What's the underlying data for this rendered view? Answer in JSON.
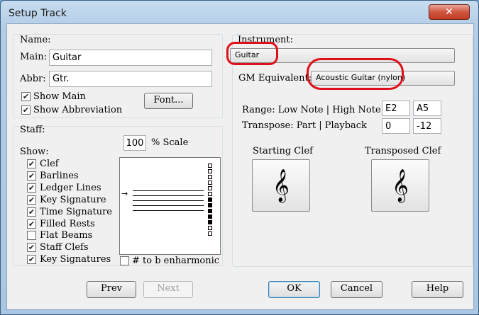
{
  "window": {
    "title": "Setup Track",
    "close_glyph": "✕"
  },
  "name_group": {
    "legend": "Name:",
    "main_label": "Main:",
    "main_value": "Guitar",
    "abbr_label": "Abbr:",
    "abbr_value": "Gtr.",
    "show_main": "Show Main",
    "show_abbreviation": "Show Abbreviation",
    "font_button": "Font..."
  },
  "staff_group": {
    "legend": "Staff:",
    "scale_value": "100",
    "scale_label": "% Scale",
    "show_label": "Show:",
    "options": [
      {
        "label": "Clef",
        "checked": true
      },
      {
        "label": "Barlines",
        "checked": true
      },
      {
        "label": "Ledger Lines",
        "checked": true
      },
      {
        "label": "Key Signature",
        "checked": true
      },
      {
        "label": "Time Signature",
        "checked": true
      },
      {
        "label": "Filled Rests",
        "checked": true
      },
      {
        "label": "Flat Beams",
        "checked": false
      },
      {
        "label": "Staff Clefs",
        "checked": true
      },
      {
        "label": "Key Signatures",
        "checked": true
      }
    ],
    "enharmonic_label": "# to b enharmonic",
    "enharmonic_checked": false
  },
  "instrument_group": {
    "legend": "Instrument:",
    "instrument_value": "Guitar",
    "gm_label": "GM Equivalent:",
    "gm_value": "Acoustic Guitar (nylon)",
    "range_label": "Range:  Low Note | High Note",
    "low_note": "E2",
    "high_note": "A5",
    "transpose_label": "Transpose:    Part | Playback",
    "transpose_part": "0",
    "transpose_playback": "-12",
    "starting_clef_label": "Starting Clef",
    "transposed_clef_label": "Transposed Clef",
    "clef_glyph": "𝄞"
  },
  "buttons": {
    "prev": "Prev",
    "next": "Next",
    "ok": "OK",
    "cancel": "Cancel",
    "help": "Help"
  },
  "colors": {
    "highlight_ring": "#e0101a"
  }
}
